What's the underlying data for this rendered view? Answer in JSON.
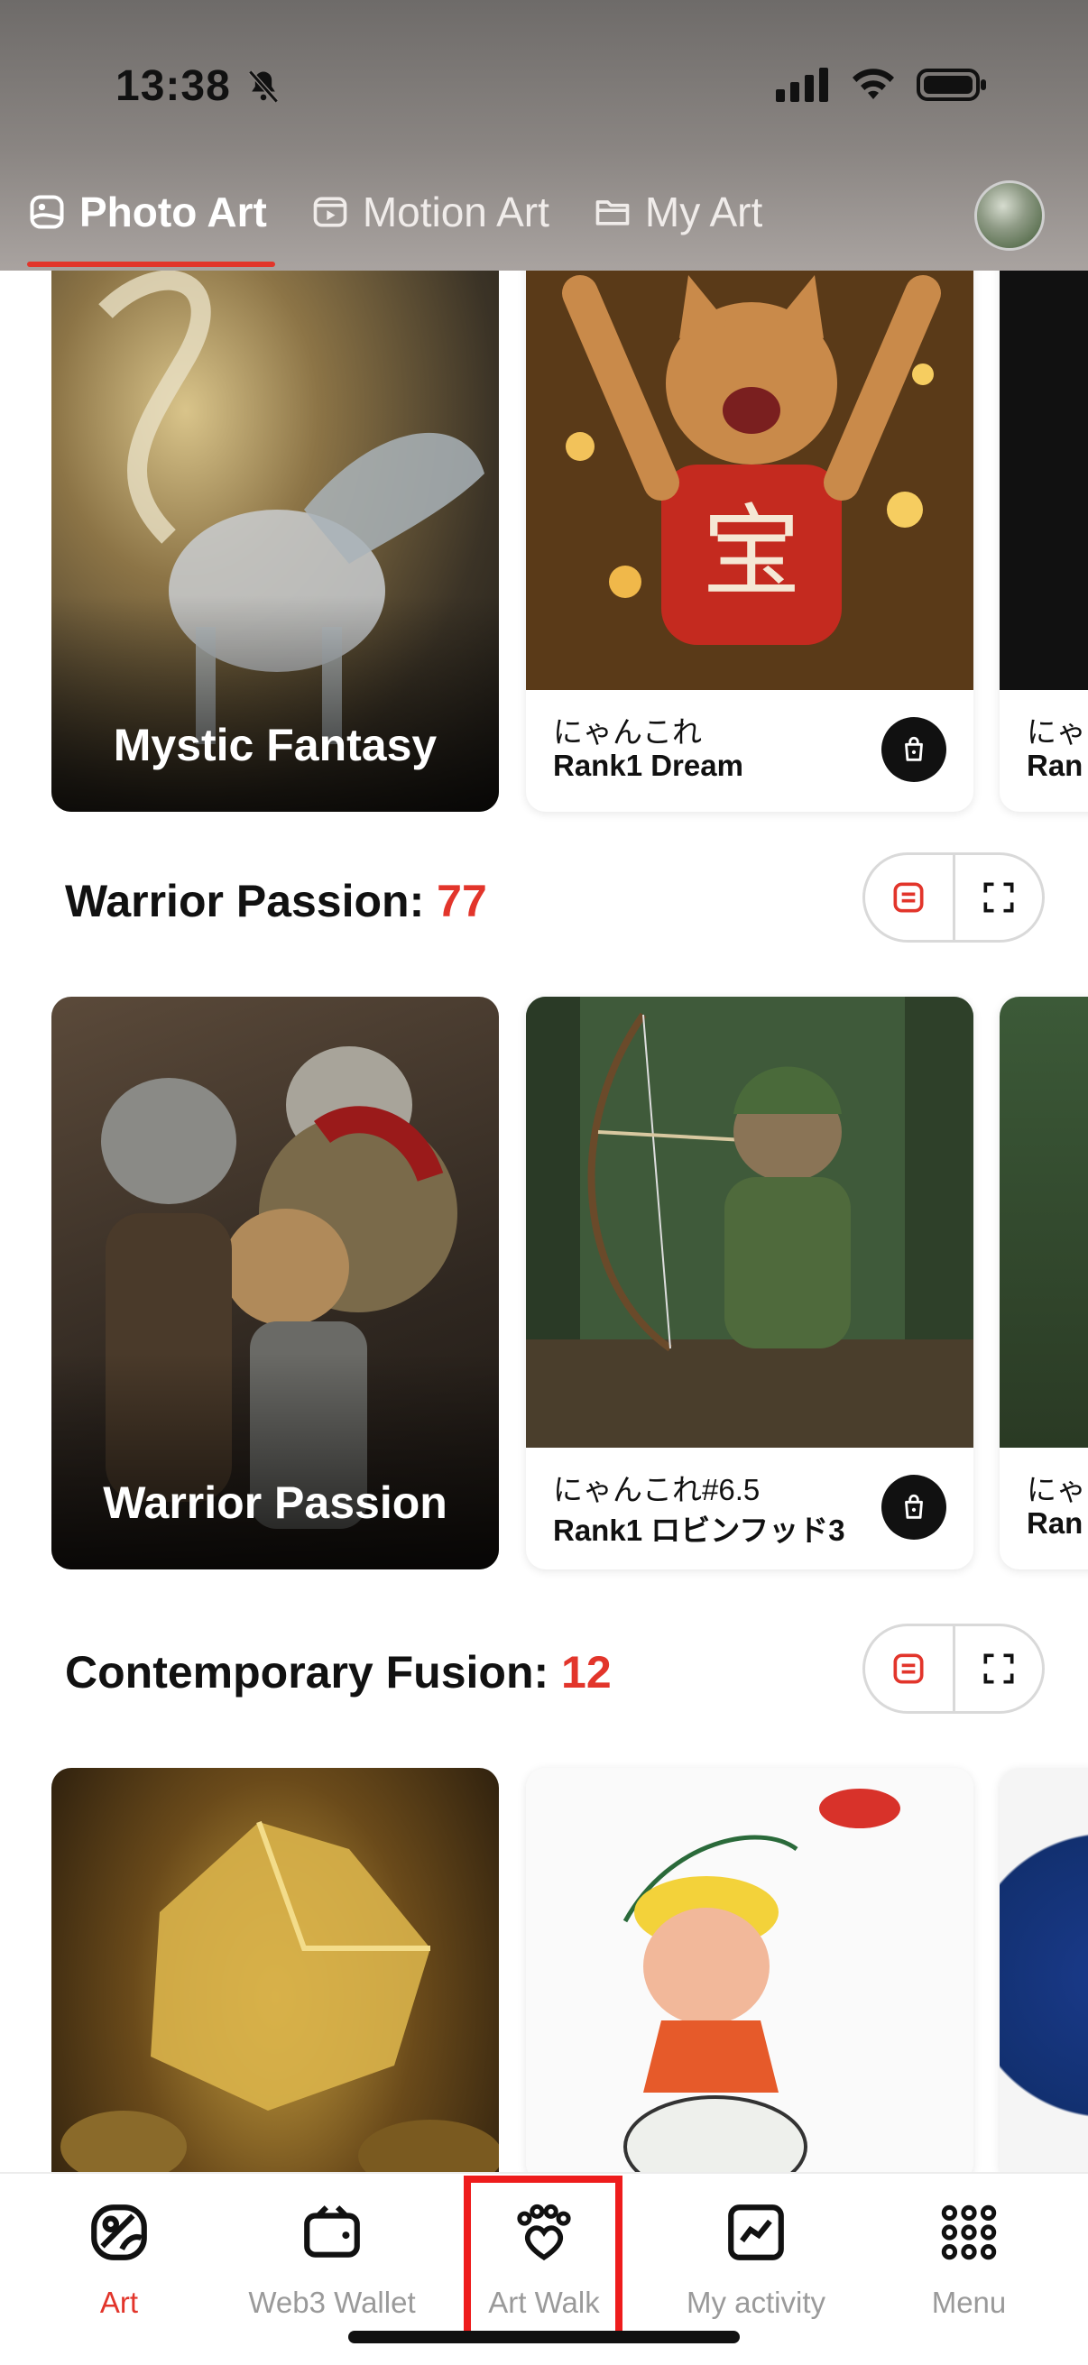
{
  "status_bar": {
    "time": "13:38"
  },
  "tabs": [
    {
      "label": "Photo Art",
      "icon": "photo-art-icon",
      "active": true
    },
    {
      "label": "Motion Art",
      "icon": "motion-art-icon",
      "active": false
    },
    {
      "label": "My Art",
      "icon": "folder-icon",
      "active": false
    }
  ],
  "sections": [
    {
      "feature_label": "Mystic Fantasy",
      "cards": [
        {
          "line1": "にゃんこれ",
          "line2": "Rank1 Dream"
        },
        {
          "line1": "にゃ",
          "line2": "Ran"
        }
      ]
    },
    {
      "title": "Warrior Passion: ",
      "count": "77",
      "feature_label": "Warrior Passion",
      "cards": [
        {
          "line1": "にゃんこれ#6.5",
          "line2": "Rank1 ロビンフッド3"
        },
        {
          "line1": "にゃ",
          "line2": "Ran"
        }
      ]
    },
    {
      "title": "Contemporary Fusion: ",
      "count": "12"
    }
  ],
  "bottom_nav": [
    {
      "label": "Art",
      "icon": "art-icon",
      "active": true
    },
    {
      "label": "Web3 Wallet",
      "icon": "wallet-icon",
      "active": false
    },
    {
      "label": "Art Walk",
      "icon": "paw-heart-icon",
      "active": false
    },
    {
      "label": "My activity",
      "icon": "activity-chart-icon",
      "active": false
    },
    {
      "label": "Menu",
      "icon": "grid-menu-icon",
      "active": false
    }
  ],
  "colors": {
    "accent": "#e2352b",
    "highlight": "#ee1c1c"
  }
}
